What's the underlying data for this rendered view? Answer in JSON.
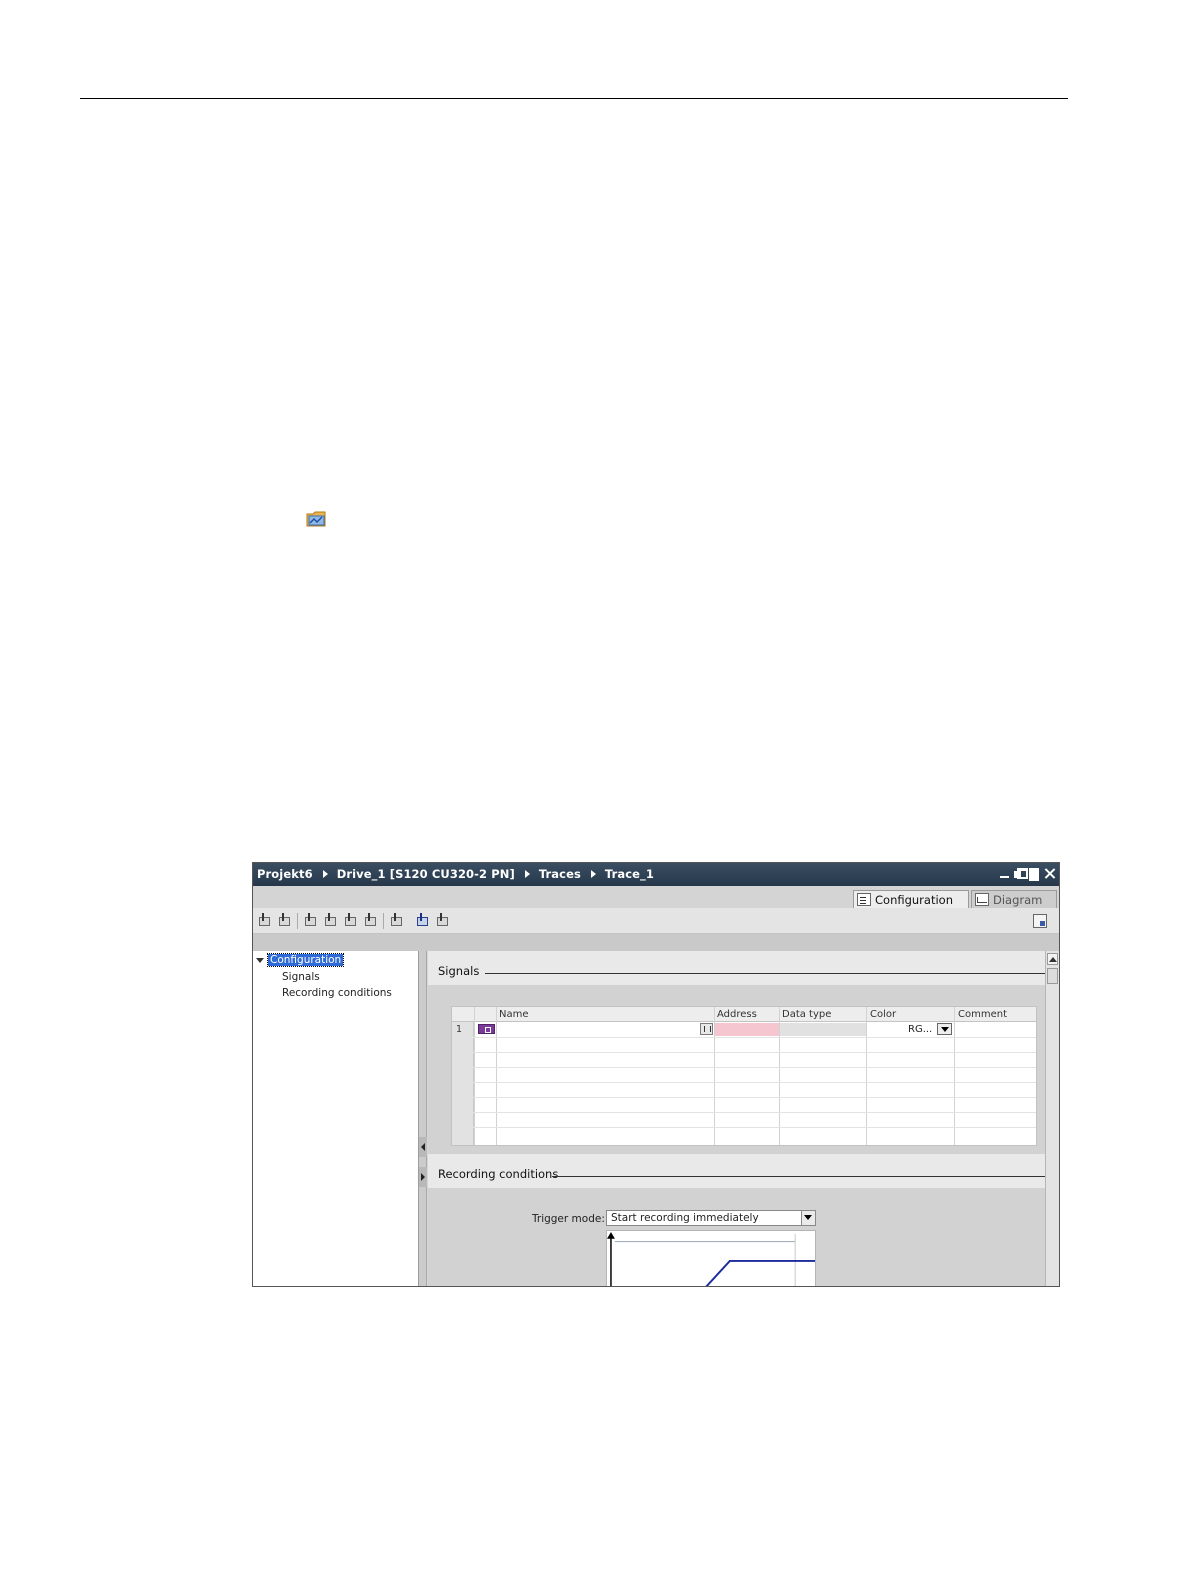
{
  "window": {
    "breadcrumb": [
      "Projekt6",
      "Drive_1 [S120 CU320-2 PN]",
      "Traces",
      "Trace_1"
    ]
  },
  "tabs": {
    "configuration": "Configuration",
    "diagram": "Diagram"
  },
  "tree": {
    "root": "Configuration",
    "children": [
      "Signals",
      "Recording conditions"
    ]
  },
  "signals": {
    "section_title": "Signals",
    "columns": [
      "Name",
      "Address",
      "Data type",
      "Color",
      "Comment"
    ],
    "rows": [
      {
        "number": "1",
        "name": "",
        "address": "",
        "data_type": "",
        "color": "RG...",
        "comment": ""
      }
    ]
  },
  "recording": {
    "section_title": "Recording conditions",
    "trigger_label": "Trigger mode:",
    "trigger_value": "Start recording immediately"
  },
  "colors": {
    "titlebar": "#2e4256",
    "selection": "#2f6bd6",
    "address_invalid": "#f5c6d0",
    "signal_line": "#1d2b9c"
  },
  "icons": [
    "trace-folder-icon",
    "minimize-icon",
    "restore-icon",
    "maximize-icon",
    "close-icon",
    "configuration-icon",
    "diagram-icon",
    "tag-icon",
    "address-picker-icon",
    "dropdown-arrow-icon"
  ]
}
